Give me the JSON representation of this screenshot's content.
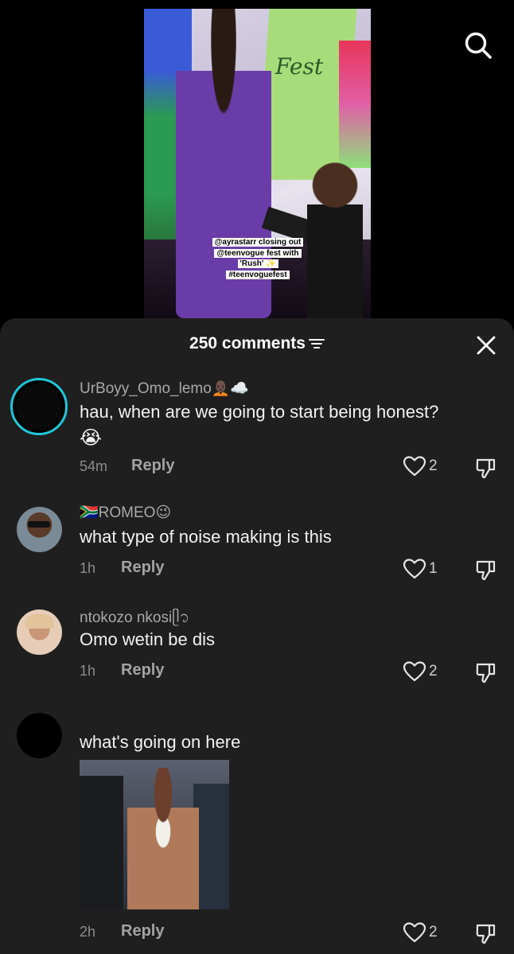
{
  "video": {
    "caption_lines": [
      "@ayrastarr closing out",
      "@teenvogue fest with",
      "'Rush' ✨",
      "#teenvoguefest"
    ],
    "banner_text": "Fest"
  },
  "header": {
    "comment_count": "250 comments"
  },
  "comments": [
    {
      "username": "UrBoyy_Omo_lemo🧑🏿‍🦲☁️",
      "text": "hau, when are we going to start being honest?",
      "emoji_line": "😭",
      "time": "54m",
      "reply": "Reply",
      "likes": "2"
    },
    {
      "username": "🇿🇦ROMEO😉",
      "text": "what type of noise making is this",
      "time": "1h",
      "reply": "Reply",
      "likes": "1"
    },
    {
      "username": "ntokozo nkosiᥫ᭡",
      "text": "Omo wetin be dis",
      "time": "1h",
      "reply": "Reply",
      "likes": "2"
    },
    {
      "username": "",
      "text": "what's going on here",
      "time": "2h",
      "reply": "Reply",
      "likes": "2"
    }
  ],
  "icons": {
    "search": "search-icon",
    "sort": "sort-icon",
    "close": "close-icon",
    "like": "heart-outline-icon",
    "dislike": "thumbs-down-icon"
  },
  "colors": {
    "panel_bg": "#1f1f1f",
    "story_ring": "#22c7d6",
    "username": "#a9a9a9",
    "text": "#f2f2f2"
  }
}
